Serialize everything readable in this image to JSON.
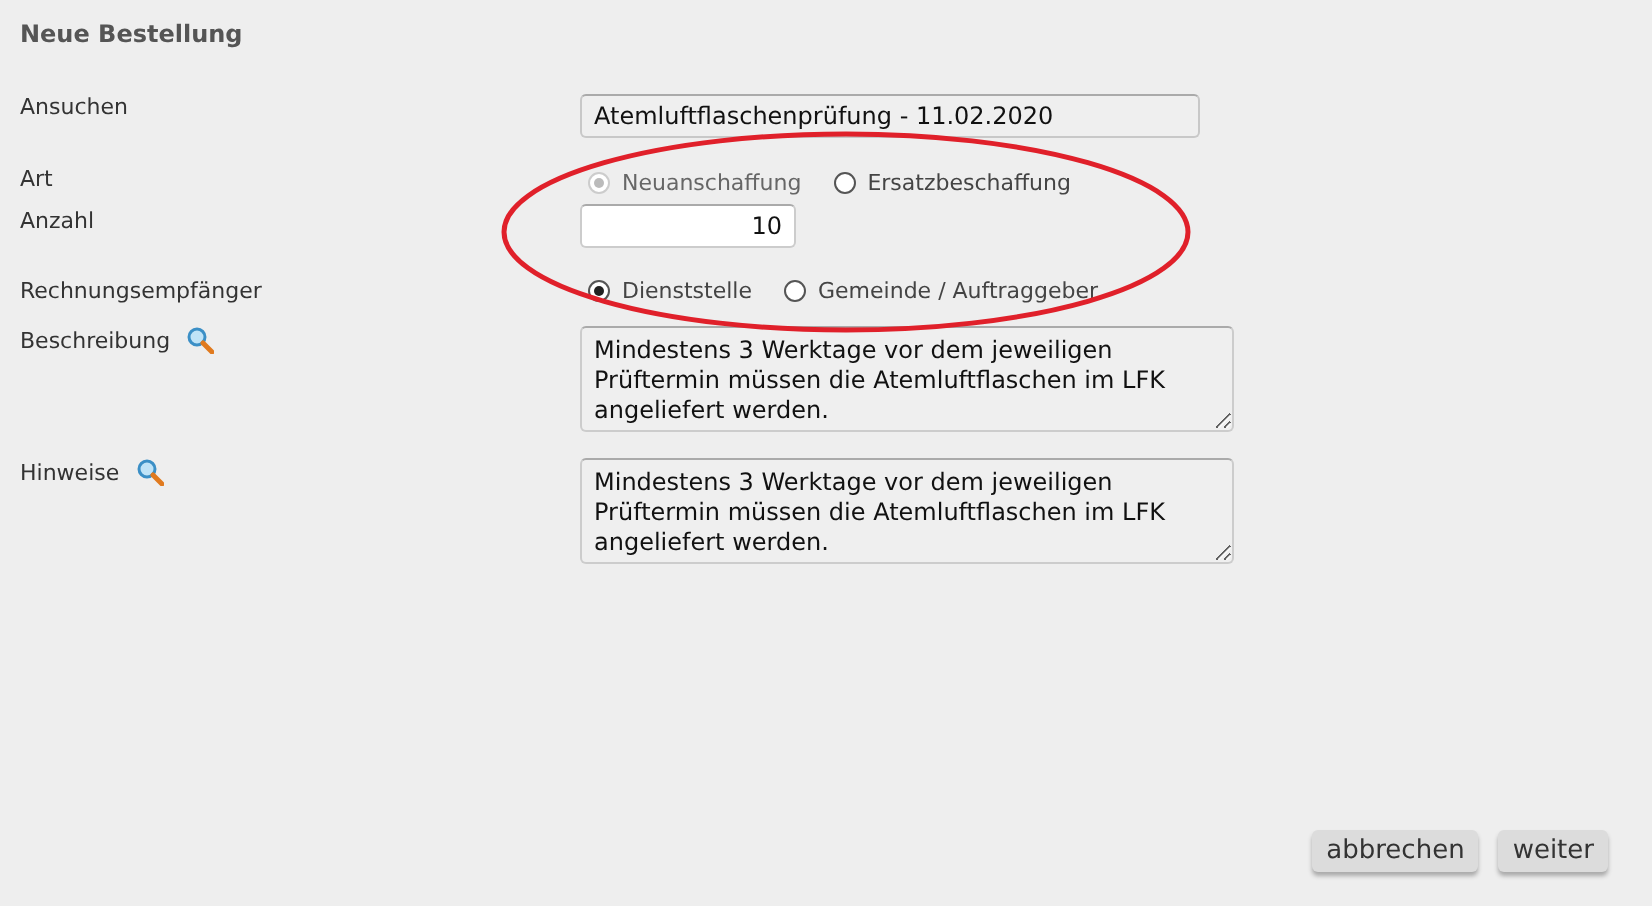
{
  "title": "Neue Bestellung",
  "fields": [
    {
      "kind": "text",
      "label": "Ansuchen",
      "value": "Atemluftflaschenprüfung - 11.02.2020"
    },
    {
      "kind": "radio",
      "label": "Art",
      "options": [
        {
          "label": "Neuanschaffung",
          "selected": true,
          "disabled": true
        },
        {
          "label": "Ersatzbeschaffung",
          "selected": false,
          "disabled": false
        }
      ]
    },
    {
      "kind": "number",
      "label": "Anzahl",
      "value": "10"
    },
    {
      "kind": "radio",
      "label": "Rechnungsempfänger",
      "options": [
        {
          "label": "Dienststelle",
          "selected": true,
          "disabled": false
        },
        {
          "label": "Gemeinde / Auftraggeber",
          "selected": false,
          "disabled": false
        }
      ]
    },
    {
      "kind": "textarea",
      "label": "Beschreibung",
      "value": "Mindestens 3 Werktage vor dem jeweiligen Prüftermin müssen die Atemluftflaschen im LFK angeliefert werden."
    },
    {
      "kind": "textarea",
      "label": "Hinweise",
      "value": "Mindestens 3 Werktage vor dem jeweiligen Prüftermin müssen die Atemluftflaschen im LFK angeliefert werden."
    }
  ],
  "buttons": [
    "abbrechen",
    "weiter"
  ]
}
